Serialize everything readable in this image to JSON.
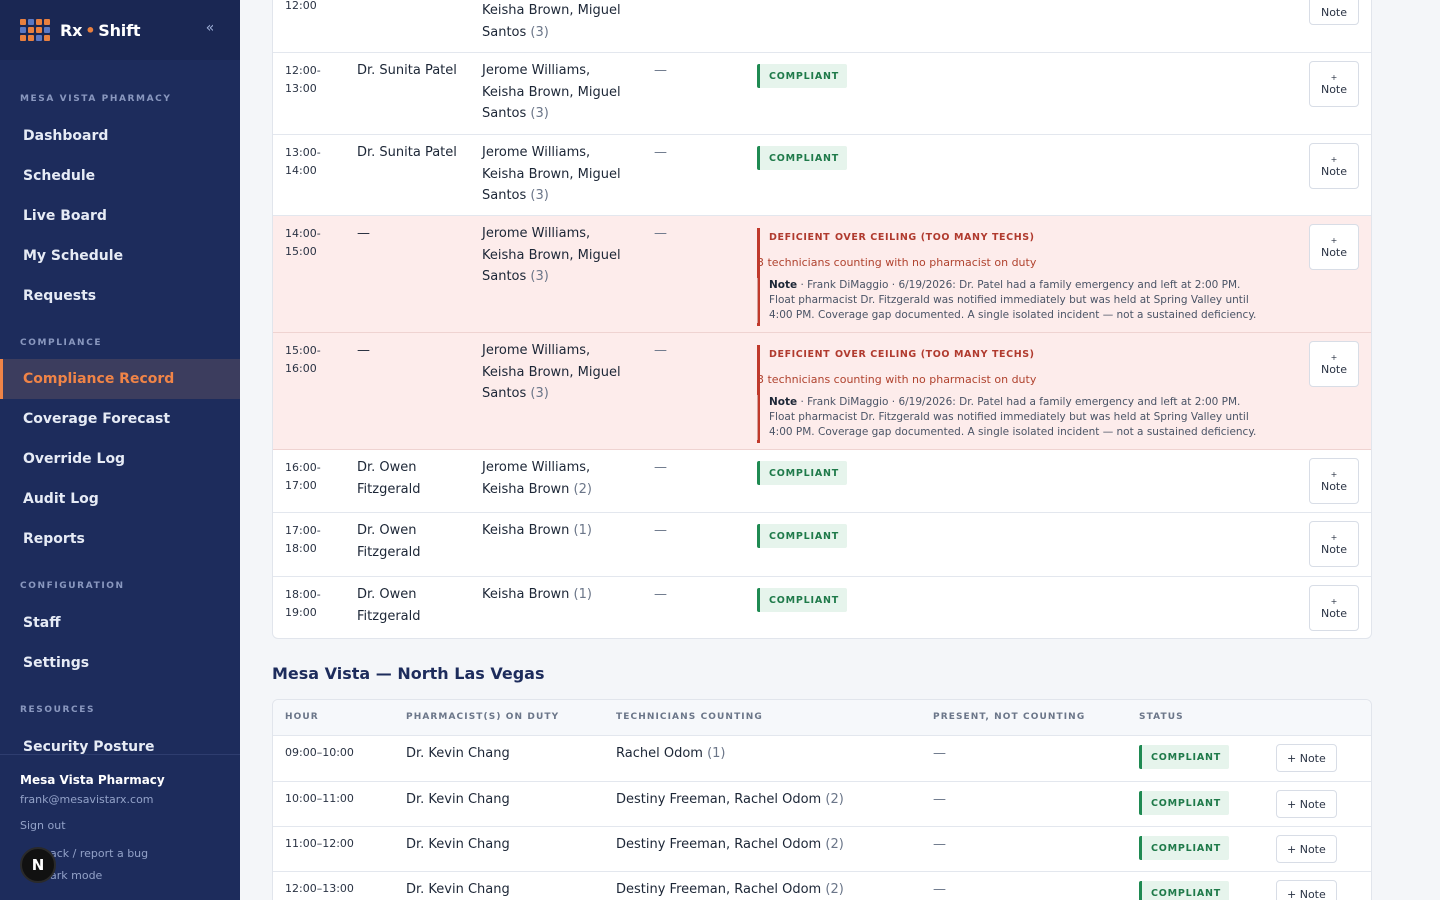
{
  "brand": {
    "name_a": "Rx",
    "name_b": "Shift",
    "collapse_icon": "double-chevron-left-icon"
  },
  "sidebar": {
    "sections": [
      {
        "label": "MESA VISTA PHARMACY"
      },
      {
        "label": "COMPLIANCE"
      },
      {
        "label": "CONFIGURATION"
      },
      {
        "label": "RESOURCES"
      }
    ],
    "items": [
      {
        "label": "Dashboard"
      },
      {
        "label": "Schedule"
      },
      {
        "label": "Live Board"
      },
      {
        "label": "My Schedule"
      },
      {
        "label": "Requests"
      },
      {
        "label": "Compliance Record",
        "active": true
      },
      {
        "label": "Coverage Forecast"
      },
      {
        "label": "Override Log"
      },
      {
        "label": "Audit Log"
      },
      {
        "label": "Reports"
      },
      {
        "label": "Staff"
      },
      {
        "label": "Settings"
      },
      {
        "label": "Security Posture"
      }
    ],
    "footer": {
      "org": "Mesa Vista Pharmacy",
      "email": "frank@mesavistarx.com",
      "sign_out": "Sign out",
      "feedback": "ack / report a bug",
      "dark_mode": "ark mode",
      "badge": "N"
    }
  },
  "table1": {
    "rows": [
      {
        "hour": "12:00",
        "pharmacist": "",
        "techs": [
          "Keisha Brown, Miguel",
          "Santos"
        ],
        "count": "(3)",
        "present": "",
        "status": "",
        "note": "Note"
      },
      {
        "hour": [
          "12:00-",
          "13:00"
        ],
        "pharmacist": [
          "Dr. Sunita Patel"
        ],
        "techs": [
          "Jerome Williams,",
          "Keisha Brown, Miguel",
          "Santos"
        ],
        "count": "(3)",
        "present": "—",
        "status": "COMPLIANT",
        "note": "Note"
      },
      {
        "hour": [
          "13:00-",
          "14:00"
        ],
        "pharmacist": [
          "Dr. Sunita Patel"
        ],
        "techs": [
          "Jerome Williams,",
          "Keisha Brown, Miguel",
          "Santos"
        ],
        "count": "(3)",
        "present": "—",
        "status": "COMPLIANT",
        "note": "Note"
      },
      {
        "hour": [
          "14:00-",
          "15:00"
        ],
        "pharmacist": [
          "—"
        ],
        "techs": [
          "Jerome Williams,",
          "Keisha Brown, Miguel",
          "Santos"
        ],
        "count": "(3)",
        "present": "—",
        "status": "DEFICIENT",
        "reason": "OVER CEILING (TOO MANY TECHS)",
        "desc": "3 technicians counting with no pharmacist on duty",
        "note_author": "Note",
        "note_body": " · Frank DiMaggio · 6/19/2026: Dr. Patel had a family emergency and left at 2:00 PM. Float pharmacist Dr. Fitzgerald was notified immediately but was held at Spring Valley until 4:00 PM. Coverage gap documented. A single isolated incident — not a sustained deficiency.",
        "note": "Note"
      },
      {
        "hour": [
          "15:00-",
          "16:00"
        ],
        "pharmacist": [
          "—"
        ],
        "techs": [
          "Jerome Williams,",
          "Keisha Brown, Miguel",
          "Santos"
        ],
        "count": "(3)",
        "present": "—",
        "status": "DEFICIENT",
        "reason": "OVER CEILING (TOO MANY TECHS)",
        "desc": "3 technicians counting with no pharmacist on duty",
        "note_author": "Note",
        "note_body": " · Frank DiMaggio · 6/19/2026: Dr. Patel had a family emergency and left at 2:00 PM. Float pharmacist Dr. Fitzgerald was notified immediately but was held at Spring Valley until 4:00 PM. Coverage gap documented. A single isolated incident — not a sustained deficiency.",
        "note": "Note"
      },
      {
        "hour": [
          "16:00-",
          "17:00"
        ],
        "pharmacist": [
          "Dr. Owen",
          "Fitzgerald"
        ],
        "techs": [
          "Jerome Williams,",
          "Keisha Brown"
        ],
        "count": "(2)",
        "present": "—",
        "status": "COMPLIANT",
        "note": "Note"
      },
      {
        "hour": [
          "17:00-",
          "18:00"
        ],
        "pharmacist": [
          "Dr. Owen",
          "Fitzgerald"
        ],
        "techs": [
          "Keisha Brown"
        ],
        "count": "(1)",
        "present": "—",
        "status": "COMPLIANT",
        "note": "Note"
      },
      {
        "hour": [
          "18:00-",
          "19:00"
        ],
        "pharmacist": [
          "Dr. Owen",
          "Fitzgerald"
        ],
        "techs": [
          "Keisha Brown"
        ],
        "count": "(1)",
        "present": "—",
        "status": "COMPLIANT",
        "note": "Note"
      }
    ]
  },
  "section2": {
    "title": "Mesa Vista — North Las Vegas",
    "headers": [
      "HOUR",
      "PHARMACIST(S) ON DUTY",
      "TECHNICIANS COUNTING",
      "PRESENT, NOT COUNTING",
      "STATUS"
    ],
    "rows": [
      {
        "hour": "09:00–10:00",
        "pharmacist": "Dr. Kevin Chang",
        "techs": "Rachel Odom",
        "count": "(1)",
        "present": "—",
        "status": "COMPLIANT",
        "note": "+ Note"
      },
      {
        "hour": "10:00–11:00",
        "pharmacist": "Dr. Kevin Chang",
        "techs": "Destiny Freeman, Rachel Odom",
        "count": "(2)",
        "present": "—",
        "status": "COMPLIANT",
        "note": "+ Note"
      },
      {
        "hour": "11:00–12:00",
        "pharmacist": "Dr. Kevin Chang",
        "techs": "Destiny Freeman, Rachel Odom",
        "count": "(2)",
        "present": "—",
        "status": "COMPLIANT",
        "note": "+ Note"
      },
      {
        "hour": "12:00–13:00",
        "pharmacist": "Dr. Kevin Chang",
        "techs": "Destiny Freeman, Rachel Odom",
        "count": "(2)",
        "present": "—",
        "status": "COMPLIANT",
        "note": "+ Note"
      }
    ]
  }
}
